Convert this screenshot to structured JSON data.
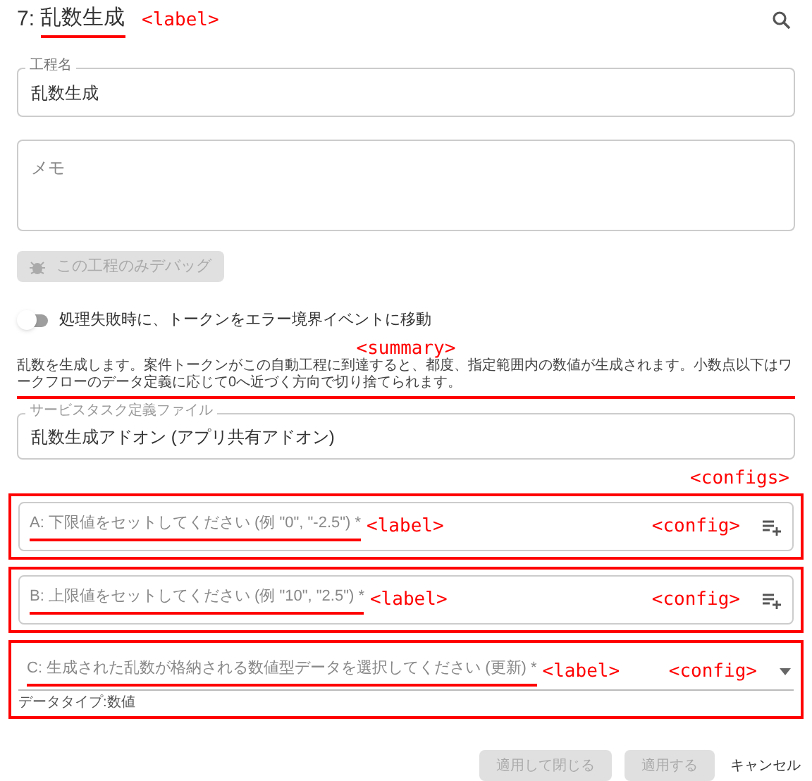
{
  "header": {
    "number": "7:",
    "title": "乱数生成",
    "annotation": "<label>"
  },
  "name_field": {
    "label": "工程名",
    "value": "乱数生成"
  },
  "memo_field": {
    "placeholder": "メモ"
  },
  "debug_button": {
    "label": "この工程のみデバッグ",
    "disabled": true
  },
  "error_toggle": {
    "label": "処理失敗時に、トークンをエラー境界イベントに移動",
    "on": false
  },
  "summary": {
    "annotation": "<summary>",
    "text": "乱数を生成します。案件トークンがこの自動工程に到達すると、都度、指定範囲内の数値が生成されます。小数点以下はワークフローのデータ定義に応じて0へ近づく方向で切り捨てられます。"
  },
  "service_field": {
    "label": "サービスタスク定義ファイル",
    "value": "乱数生成アドオン (アプリ共有アドオン)"
  },
  "configs": {
    "annotation": "<configs>",
    "items": [
      {
        "kind": "input",
        "placeholder": "A: 下限値をセットしてください (例 \"0\", \"-2.5\") *",
        "label_annotation": "<label>",
        "config_annotation": "<config>"
      },
      {
        "kind": "input",
        "placeholder": "B: 上限値をセットしてください (例 \"10\", \"2.5\") *",
        "label_annotation": "<label>",
        "config_annotation": "<config>"
      },
      {
        "kind": "select",
        "placeholder": "C: 生成された乱数が格納される数値型データを選択してください (更新) *",
        "label_annotation": "<label>",
        "config_annotation": "<config>",
        "helper": "データタイプ:数値"
      }
    ]
  },
  "footer": [
    {
      "label": "適用して閉じる",
      "kind": "filled",
      "disabled": true
    },
    {
      "label": "適用する",
      "kind": "filled",
      "disabled": true
    },
    {
      "label": "キャンセル",
      "kind": "text",
      "disabled": false
    }
  ]
}
